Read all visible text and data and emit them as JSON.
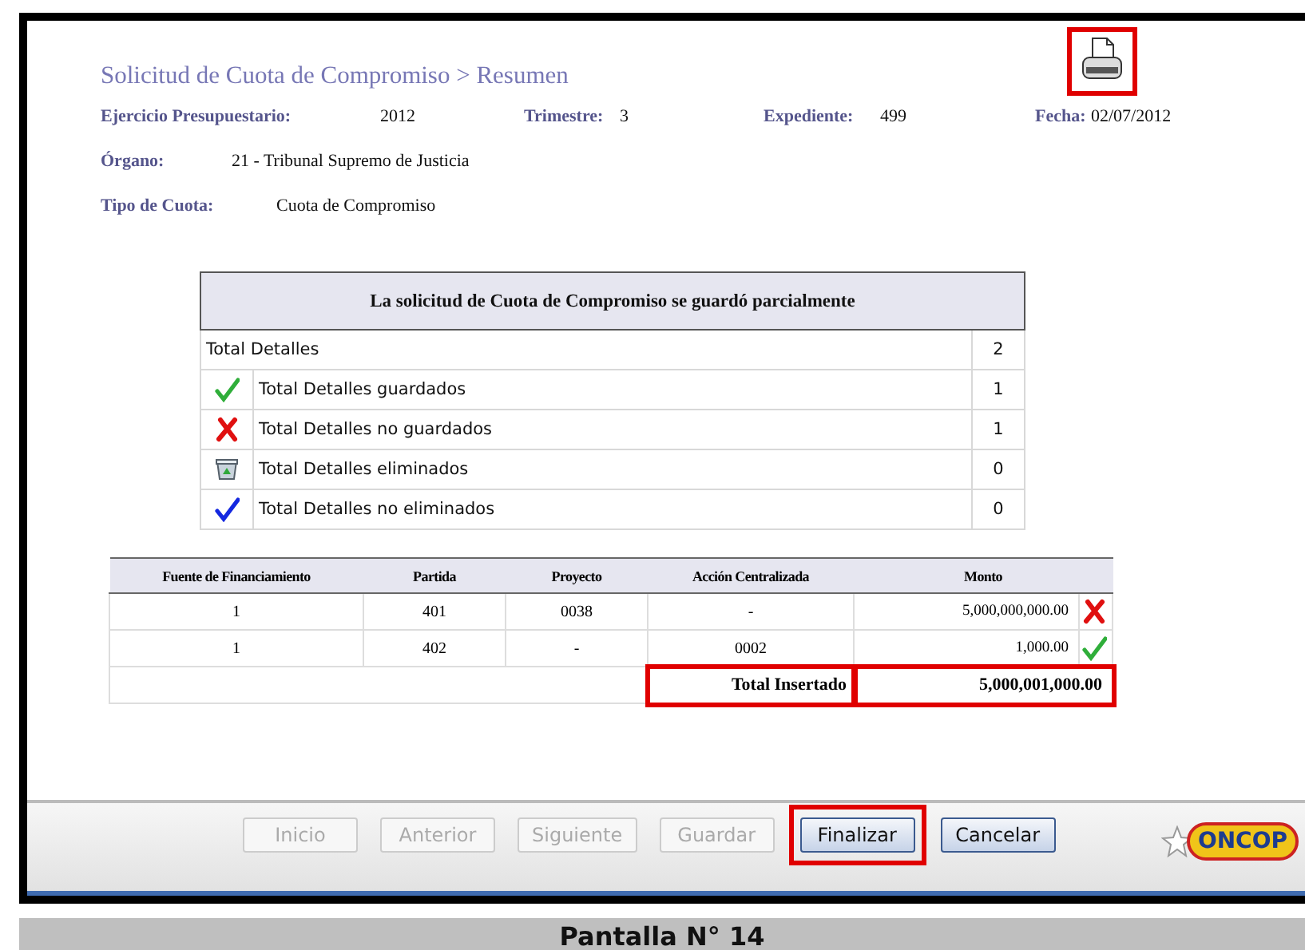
{
  "page": {
    "title": "Solicitud de Cuota de Compromiso > Resumen",
    "print_highlighted": true
  },
  "info": [
    {
      "label": "Ejercicio Presupuestario:",
      "value": "2012"
    },
    {
      "label": "Trimestre:",
      "value": "3"
    },
    {
      "label": "Expediente:",
      "value": "499"
    },
    {
      "label": "Fecha:",
      "value": "02/07/2012"
    }
  ],
  "organo": {
    "label": "Órgano:",
    "value": "21 - Tribunal Supremo de Justicia"
  },
  "tipo": {
    "label": "Tipo de Cuota:",
    "value": "Cuota de Compromiso"
  },
  "summary": {
    "heading": "La solicitud de Cuota de Compromiso se guardó parcialmente",
    "total": {
      "label": "Total Detalles",
      "value": "2"
    },
    "rows": [
      {
        "kind": "saved",
        "label": "Total Detalles guardados",
        "value": "1"
      },
      {
        "kind": "not-saved",
        "label": "Total Detalles no guardados",
        "value": "1"
      },
      {
        "kind": "deleted",
        "label": "Total Detalles eliminados",
        "value": "0"
      },
      {
        "kind": "not-deleted",
        "label": "Total Detalles no eliminados",
        "value": "0"
      }
    ]
  },
  "details": {
    "columns": [
      "Fuente de Financiamiento",
      "Partida",
      "Proyecto",
      "Acción Centralizada",
      "Monto"
    ],
    "rows": [
      {
        "cells": [
          "1",
          "401",
          "0038",
          "-",
          "5,000,000,000.00"
        ],
        "kind": "error"
      },
      {
        "cells": [
          "1",
          "402",
          "-",
          "0002",
          "1,000.00"
        ],
        "kind": "ok"
      }
    ],
    "total": {
      "label": "Total Insertado",
      "value": "5,000,001,000.00",
      "highlighted": true
    }
  },
  "buttons": [
    {
      "label": "Inicio",
      "disabled": true,
      "highlighted": false
    },
    {
      "label": "Anterior",
      "disabled": true,
      "highlighted": false
    },
    {
      "label": "Siguiente",
      "disabled": true,
      "highlighted": false
    },
    {
      "label": "Guardar",
      "disabled": true,
      "highlighted": false
    },
    {
      "label": "Finalizar",
      "disabled": false,
      "highlighted": true
    },
    {
      "label": "Cancelar",
      "disabled": false,
      "highlighted": false
    }
  ],
  "logo": {
    "text": "ONCOP"
  },
  "caption": "Pantalla N° 14"
}
